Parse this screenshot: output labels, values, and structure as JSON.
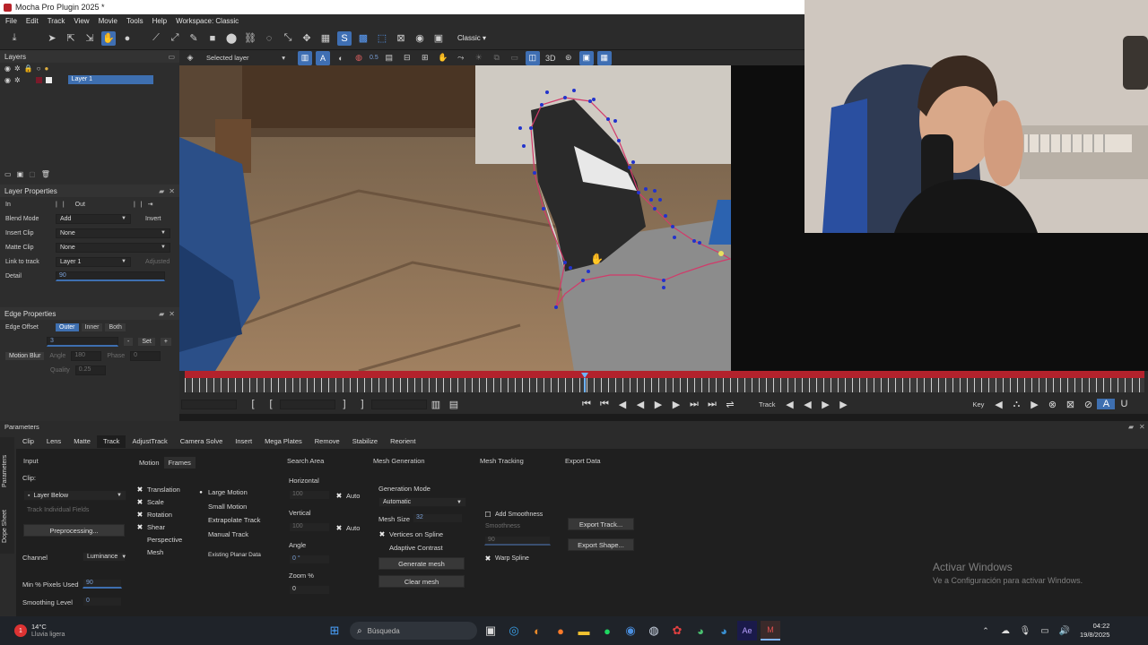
{
  "window": {
    "title": "Mocha Pro Plugin 2025 *"
  },
  "menu": [
    "File",
    "Edit",
    "Track",
    "View",
    "Movie",
    "Tools",
    "Help",
    "Workspace: Classic"
  ],
  "toolbar": {
    "workspace_select": "Classic"
  },
  "viewer_bar": {
    "layer_select": "Selected layer",
    "opacity": "0.5"
  },
  "layers_panel": {
    "title": "Layers",
    "layers": [
      {
        "name": "Layer 1"
      }
    ]
  },
  "layer_properties": {
    "title": "Layer Properties",
    "in_label": "In",
    "out_label": "Out",
    "blend_mode_label": "Blend Mode",
    "blend_mode": "Add",
    "invert_label": "Invert",
    "insert_clip_label": "Insert Clip",
    "insert_clip": "None",
    "matte_clip_label": "Matte Clip",
    "matte_clip": "None",
    "link_to_track_label": "Link to track",
    "link_to_track": "Layer 1",
    "adjusted_label": "Adjusted",
    "detail_label": "Detail",
    "detail_value": "90"
  },
  "edge_properties": {
    "title": "Edge Properties",
    "edge_offset_label": "Edge Offset",
    "modes": [
      "Outer",
      "Inner",
      "Both"
    ],
    "active_mode": "Outer",
    "offset_value": "3",
    "set_label": "Set",
    "motion_blur_label": "Motion Blur",
    "angle_label": "Angle",
    "angle_value": "180",
    "phase_label": "Phase",
    "phase_value": "0",
    "quality_label": "Quality",
    "quality_value": "0.25"
  },
  "transport": {
    "track_label": "Track",
    "key_label": "Key"
  },
  "parameters": {
    "title": "Parameters",
    "side_tabs": [
      "Parameters",
      "Dope Sheet"
    ],
    "tabs": [
      "Clip",
      "Lens",
      "Matte",
      "Track",
      "AdjustTrack",
      "Camera Solve",
      "Insert",
      "Mega Plates",
      "Remove",
      "Stabilize",
      "Reorient"
    ],
    "active_tab": "Track",
    "input": {
      "title": "Input",
      "clip_label": "Clip:",
      "clip_value": "Layer Below",
      "track_individual_fields": "Track Individual Fields",
      "preprocessing_label": "Preprocessing...",
      "channel_label": "Channel",
      "channel_value": "Luminance",
      "min_pixels_label": "Min % Pixels Used",
      "min_pixels_value": "90",
      "smoothing_label": "Smoothing Level",
      "smoothing_value": "0"
    },
    "motion": {
      "tabs": [
        "Motion",
        "Frames"
      ],
      "active_tab": "Frames",
      "checks": [
        {
          "label": "Translation",
          "checked": true
        },
        {
          "label": "Scale",
          "checked": true
        },
        {
          "label": "Rotation",
          "checked": true
        },
        {
          "label": "Shear",
          "checked": true
        },
        {
          "label": "Perspective",
          "checked": false
        },
        {
          "label": "Mesh",
          "checked": false
        }
      ],
      "options": [
        "Large Motion",
        "Small Motion",
        "Extrapolate Track",
        "Manual Track",
        "Existing Planar Data"
      ],
      "selected_option": "Large Motion"
    },
    "search_area": {
      "title": "Search Area",
      "horizontal_label": "Horizontal",
      "horizontal_value": "100",
      "vertical_label": "Vertical",
      "vertical_value": "100",
      "auto_label": "Auto",
      "angle_label": "Angle",
      "angle_value": "0 °",
      "zoom_label": "Zoom %",
      "zoom_value": "0"
    },
    "mesh_generation": {
      "title": "Mesh Generation",
      "mode_label": "Generation Mode",
      "mode_value": "Automatic",
      "mesh_size_label": "Mesh Size",
      "mesh_size_value": "32",
      "vertices_on_spline": "Vertices on Spline",
      "adaptive_contrast": "Adaptive Contrast",
      "generate_label": "Generate mesh",
      "clear_label": "Clear mesh"
    },
    "mesh_tracking": {
      "title": "Mesh Tracking",
      "add_smoothness": "Add Smoothness",
      "smoothness": "Smoothness",
      "smoothness_value": "90",
      "warp_spline": "Warp Spline"
    },
    "export_data": {
      "title": "Export Data",
      "export_track": "Export Track...",
      "export_shape": "Export Shape..."
    }
  },
  "watermark": {
    "line1": "Activar Windows",
    "line2": "Ve a Configuración para activar Windows."
  },
  "taskbar": {
    "weather_temp": "14°C",
    "weather_desc": "Lluvia ligera",
    "weather_badge": "1",
    "search_placeholder": "Búsqueda",
    "time": "04:22",
    "date": "19/8/2025"
  },
  "colors": {
    "accent": "#3e6fb0",
    "timeline_red": "#b3222c",
    "spline": "#d23a6a",
    "points": "#2233cc"
  }
}
